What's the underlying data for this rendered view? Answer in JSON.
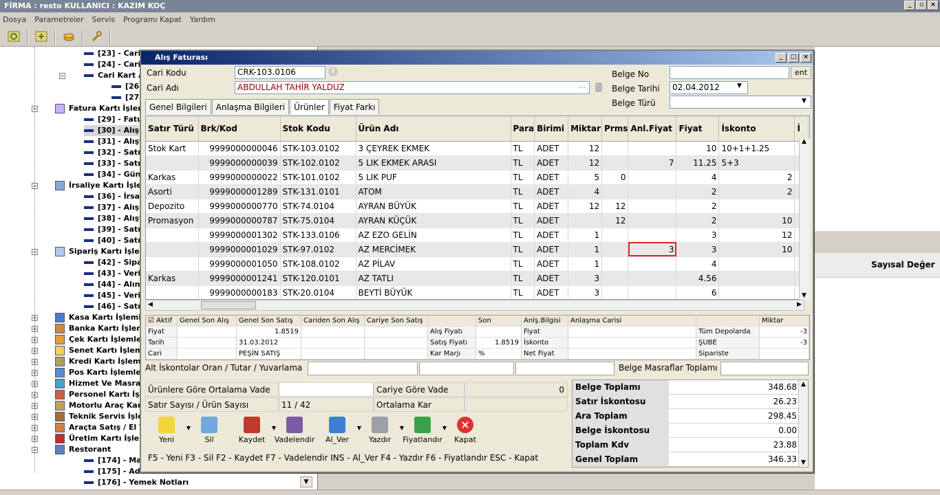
{
  "window": {
    "title": "FİRMA : resto    KULLANICI : KAZIM KOÇ"
  },
  "menu": [
    "Dosya",
    "Parametreler",
    "Servis",
    "Programı Kapat",
    "Yardım"
  ],
  "toolbar_icons": [
    "refresh-icon",
    "add-window-icon",
    "coins-icon",
    "wrench-icon"
  ],
  "tree": {
    "items": [
      {
        "label": "[23] - Cari",
        "type": "leaf",
        "indent": 3
      },
      {
        "label": "[24] - Cari",
        "type": "leaf",
        "indent": 3
      },
      {
        "label": "Cari Kart A",
        "type": "leaf",
        "indent": 3,
        "expander": "−"
      },
      {
        "label": "[26",
        "type": "leaf",
        "indent": 4
      },
      {
        "label": "[27",
        "type": "leaf",
        "indent": 4
      },
      {
        "label": "Fatura Kartı İşler",
        "type": "group",
        "indent": 1,
        "expander": "−"
      },
      {
        "label": "[29] - Fatu",
        "type": "leaf",
        "indent": 2
      },
      {
        "label": "[30] - Alış",
        "type": "leaf",
        "indent": 2,
        "selected": true
      },
      {
        "label": "[31] - Alışt",
        "type": "leaf",
        "indent": 2
      },
      {
        "label": "[32] - Satış",
        "type": "leaf",
        "indent": 2
      },
      {
        "label": "[33] - Satış",
        "type": "leaf",
        "indent": 2
      },
      {
        "label": "[34] - Günl",
        "type": "leaf",
        "indent": 2
      },
      {
        "label": "İrsaliye Kartı İşle",
        "type": "group",
        "indent": 1,
        "expander": "−"
      },
      {
        "label": "[36] - İrsal",
        "type": "leaf",
        "indent": 2
      },
      {
        "label": "[37] - Alış",
        "type": "leaf",
        "indent": 2
      },
      {
        "label": "[38] - Alışt",
        "type": "leaf",
        "indent": 2
      },
      {
        "label": "[39] - Satış",
        "type": "leaf",
        "indent": 2
      },
      {
        "label": "[40] - Satış",
        "type": "leaf",
        "indent": 2
      },
      {
        "label": "Sipariş Kartı İşlem",
        "type": "group",
        "indent": 1,
        "expander": "−"
      },
      {
        "label": "[42] - Sipa",
        "type": "leaf",
        "indent": 2
      },
      {
        "label": "[43] - Veril",
        "type": "leaf",
        "indent": 2
      },
      {
        "label": "[44] - Alına",
        "type": "leaf",
        "indent": 2
      },
      {
        "label": "[45] - Veril",
        "type": "leaf",
        "indent": 2
      },
      {
        "label": "[46] - Satış",
        "type": "leaf",
        "indent": 2
      },
      {
        "label": "Kasa Kartı İşleml",
        "type": "group",
        "indent": 1,
        "expander": "+"
      },
      {
        "label": "Banka Kartı İşlem",
        "type": "group",
        "indent": 1,
        "expander": "+"
      },
      {
        "label": "Çek Kartı İşlemler",
        "type": "group",
        "indent": 1,
        "expander": "+"
      },
      {
        "label": "Senet Kartı İşlem",
        "type": "group",
        "indent": 1,
        "expander": "+"
      },
      {
        "label": "Kredi Kartı İşleml",
        "type": "group",
        "indent": 1,
        "expander": "+"
      },
      {
        "label": "Pos Kartı İşlemler",
        "type": "group",
        "indent": 1,
        "expander": "+"
      },
      {
        "label": "Hizmet Ve Masraf",
        "type": "group",
        "indent": 1,
        "expander": "+"
      },
      {
        "label": "Personel Kartı İşl",
        "type": "group",
        "indent": 1,
        "expander": "+"
      },
      {
        "label": "Motorlu Araç Kart",
        "type": "group",
        "indent": 1,
        "expander": "+"
      },
      {
        "label": "Teknik Servis İşle",
        "type": "group",
        "indent": 1,
        "expander": "+"
      },
      {
        "label": "Araçta Satış / El T",
        "type": "group",
        "indent": 1,
        "expander": "+"
      },
      {
        "label": "Üretim Kartı İşlen",
        "type": "group",
        "indent": 1,
        "expander": "+"
      },
      {
        "label": "Restorant",
        "type": "group",
        "indent": 1,
        "expander": "−"
      },
      {
        "label": "[174] - Ma",
        "type": "leaf",
        "indent": 2
      },
      {
        "label": "[175] - Adi",
        "type": "leaf",
        "indent": 2
      },
      {
        "label": "[176] - Yemek Notları",
        "type": "leaf",
        "indent": 2
      }
    ]
  },
  "rightpane": {
    "header": "Sayısal Değer"
  },
  "dialog": {
    "title": "Alış Faturası",
    "cari_kodu_label": "Cari Kodu",
    "cari_kodu": "CRK-103.0106",
    "cari_adi_label": "Cari  Adı",
    "cari_adi": "ABDULLAH TAHİR YALDUZ",
    "belge_no_label": "Belge No",
    "belge_no": "",
    "ent_button": "ent",
    "belge_tarihi_label": "Belge Tarihi",
    "belge_tarihi": "02.04.2012",
    "belge_turu_label": "Belge Türü",
    "belge_turu": "",
    "tabs": [
      "Genel Bilgileri",
      "Anlaşma Bilgileri",
      "Ürünler",
      "Fiyat Farkı"
    ],
    "active_tab": 2
  },
  "grid": {
    "columns": [
      "Satır Türü",
      "Brk/Kod",
      "Stok Kodu",
      "Ürün Adı",
      "Para",
      "Birimi",
      "Miktar",
      "Prms",
      "Anl.Fiyat",
      "Fiyat",
      "İskonto",
      "İ"
    ],
    "rows": [
      [
        "Stok Kart",
        "9999000000046",
        "STK-103.0102",
        "3 ÇEYREK EKMEK",
        "TL",
        "ADET",
        "12",
        "",
        "",
        "10",
        "10+1+1.25",
        ""
      ],
      [
        "",
        "9999000000039",
        "STK-102.0102",
        "5 LIK EKMEK ARASI",
        "TL",
        "ADET",
        "12",
        "",
        "7",
        "11.25",
        "5+3",
        ""
      ],
      [
        "Karkas",
        "9999000000022",
        "STK-101.0102",
        "5 LIK PUF",
        "TL",
        "ADET",
        "5",
        "0",
        "",
        "4",
        "2",
        ""
      ],
      [
        "Asorti",
        "9999000001289",
        "STK-131.0101",
        "ATOM",
        "TL",
        "ADET",
        "4",
        "",
        "",
        "2",
        "2",
        ""
      ],
      [
        "Depozito",
        "9999000000770",
        "STK-74.0104",
        "AYRAN BÜYÜK",
        "TL",
        "ADET",
        "12",
        "12",
        "",
        "2",
        "",
        ""
      ],
      [
        "Promasyon",
        "9999000000787",
        "STK-75.0104",
        "AYRAN KÜÇÜK",
        "TL",
        "ADET",
        "",
        "12",
        "",
        "2",
        "10",
        ""
      ],
      [
        "",
        "9999000001302",
        "STK-133.0106",
        "AZ EZO GELİN",
        "TL",
        "ADET",
        "1",
        "",
        "",
        "3",
        "12",
        ""
      ],
      [
        "",
        "9999000001029",
        "STK-97.0102",
        "AZ MERCİMEK",
        "TL",
        "ADET",
        "1",
        "",
        "3",
        "3",
        "10",
        ""
      ],
      [
        "",
        "9999000001050",
        "STK-108.0102",
        "AZ PİLAV",
        "TL",
        "ADET",
        "1",
        "",
        "",
        "4",
        "",
        ""
      ],
      [
        "Karkas",
        "9999000001241",
        "STK-120.0101",
        "AZ TATLI",
        "TL",
        "ADET",
        "3",
        "",
        "",
        "4.56",
        "",
        ""
      ],
      [
        "",
        "9999000000183",
        "STK-20.0104",
        "BEYTİ BÜYÜK",
        "TL",
        "ADET",
        "3",
        "",
        "",
        "6",
        "",
        ""
      ]
    ]
  },
  "info": {
    "aktif": "Aktif",
    "headers": [
      "Genel Son Alış",
      "Genel Son Satış",
      "Cariden Son Alış",
      "Cariye Son Satış",
      "",
      "Son",
      "Anlş.Bilgisi",
      "Anlaşma Carisi",
      "",
      "Miktar"
    ],
    "rows": [
      {
        "label": "Fiyat",
        "genel_son_satis": "1.8519",
        "mid_label": "Alış Fiyatı",
        "mid_value": "",
        "anl_label": "Fiyat",
        "dep_label": "Tüm Depolarda",
        "dep_value": "-3"
      },
      {
        "label": "Tarih",
        "genel_son_satis": "31.03.2012",
        "mid_label": "Satış Fiyatı",
        "mid_value": "1.8519",
        "anl_label": "İskonto",
        "dep_label": "ŞUBE",
        "dep_value": "-3"
      },
      {
        "label": "Cari",
        "genel_son_satis": "PEŞİN SATIŞ",
        "mid_label": "Kar Marjı",
        "mid_value": "%",
        "anl_label": "Net Fiyat",
        "dep_label": "Sipariste",
        "dep_value": ""
      }
    ]
  },
  "alt_iskonto_label": "Alt İskontolar Oran / Tutar / Yuvarlama",
  "belge_masraf_label": "Belge Masraflar Toplamı",
  "vade": {
    "urun_vade_label": "Ürünlere Göre Ortalama Vade",
    "urun_vade": "",
    "cari_vade_label": "Cariye Göre Vade",
    "cari_vade": "0",
    "satir_label": "Satır Sayısı / Ürün Sayısı",
    "satir_value": "11 / 42",
    "kar_label": "Ortalama Kar",
    "kar_value": ""
  },
  "totals": [
    {
      "label": "Belge Toplamı",
      "value": "348.68"
    },
    {
      "label": "Satır İskontosu",
      "value": "26.23"
    },
    {
      "label": "Ara Toplam",
      "value": "298.45"
    },
    {
      "label": "Belge İskontosu",
      "value": "0.00"
    },
    {
      "label": "Toplam Kdv",
      "value": "23.88"
    },
    {
      "label": "Genel Toplam",
      "value": "346.33"
    }
  ],
  "actions": [
    {
      "label": "Yeni",
      "icon": "new-note-icon",
      "color": "#f5d63a",
      "dropdown": true
    },
    {
      "label": "Sil",
      "icon": "trash-icon",
      "color": "#6fa8dc",
      "dropdown": false
    },
    {
      "label": "Kaydet",
      "icon": "save-disk-icon",
      "color": "#c0392b",
      "dropdown": true
    },
    {
      "label": "Vadelendir",
      "icon": "user-add-icon",
      "color": "#7d5ba6",
      "dropdown": false
    },
    {
      "label": "Al_Ver",
      "icon": "document-arrow-icon",
      "color": "#3d7fd1",
      "dropdown": true
    },
    {
      "label": "Yazdır",
      "icon": "printer-icon",
      "color": "#9aa0a6",
      "dropdown": true
    },
    {
      "label": "Fiyatlandır",
      "icon": "money-add-icon",
      "color": "#3aa14a",
      "dropdown": true
    },
    {
      "label": "Kapat",
      "icon": "close-circle-icon",
      "color": "#e03030",
      "dropdown": false
    }
  ],
  "shortcuts": "F5 - Yeni  F3 - Sil  F2 - Kaydet  F7 - Vadelendir  INS - Al_Ver  F4 - Yazdır  F6 - Fiyatlandır  ESC - Kapat"
}
